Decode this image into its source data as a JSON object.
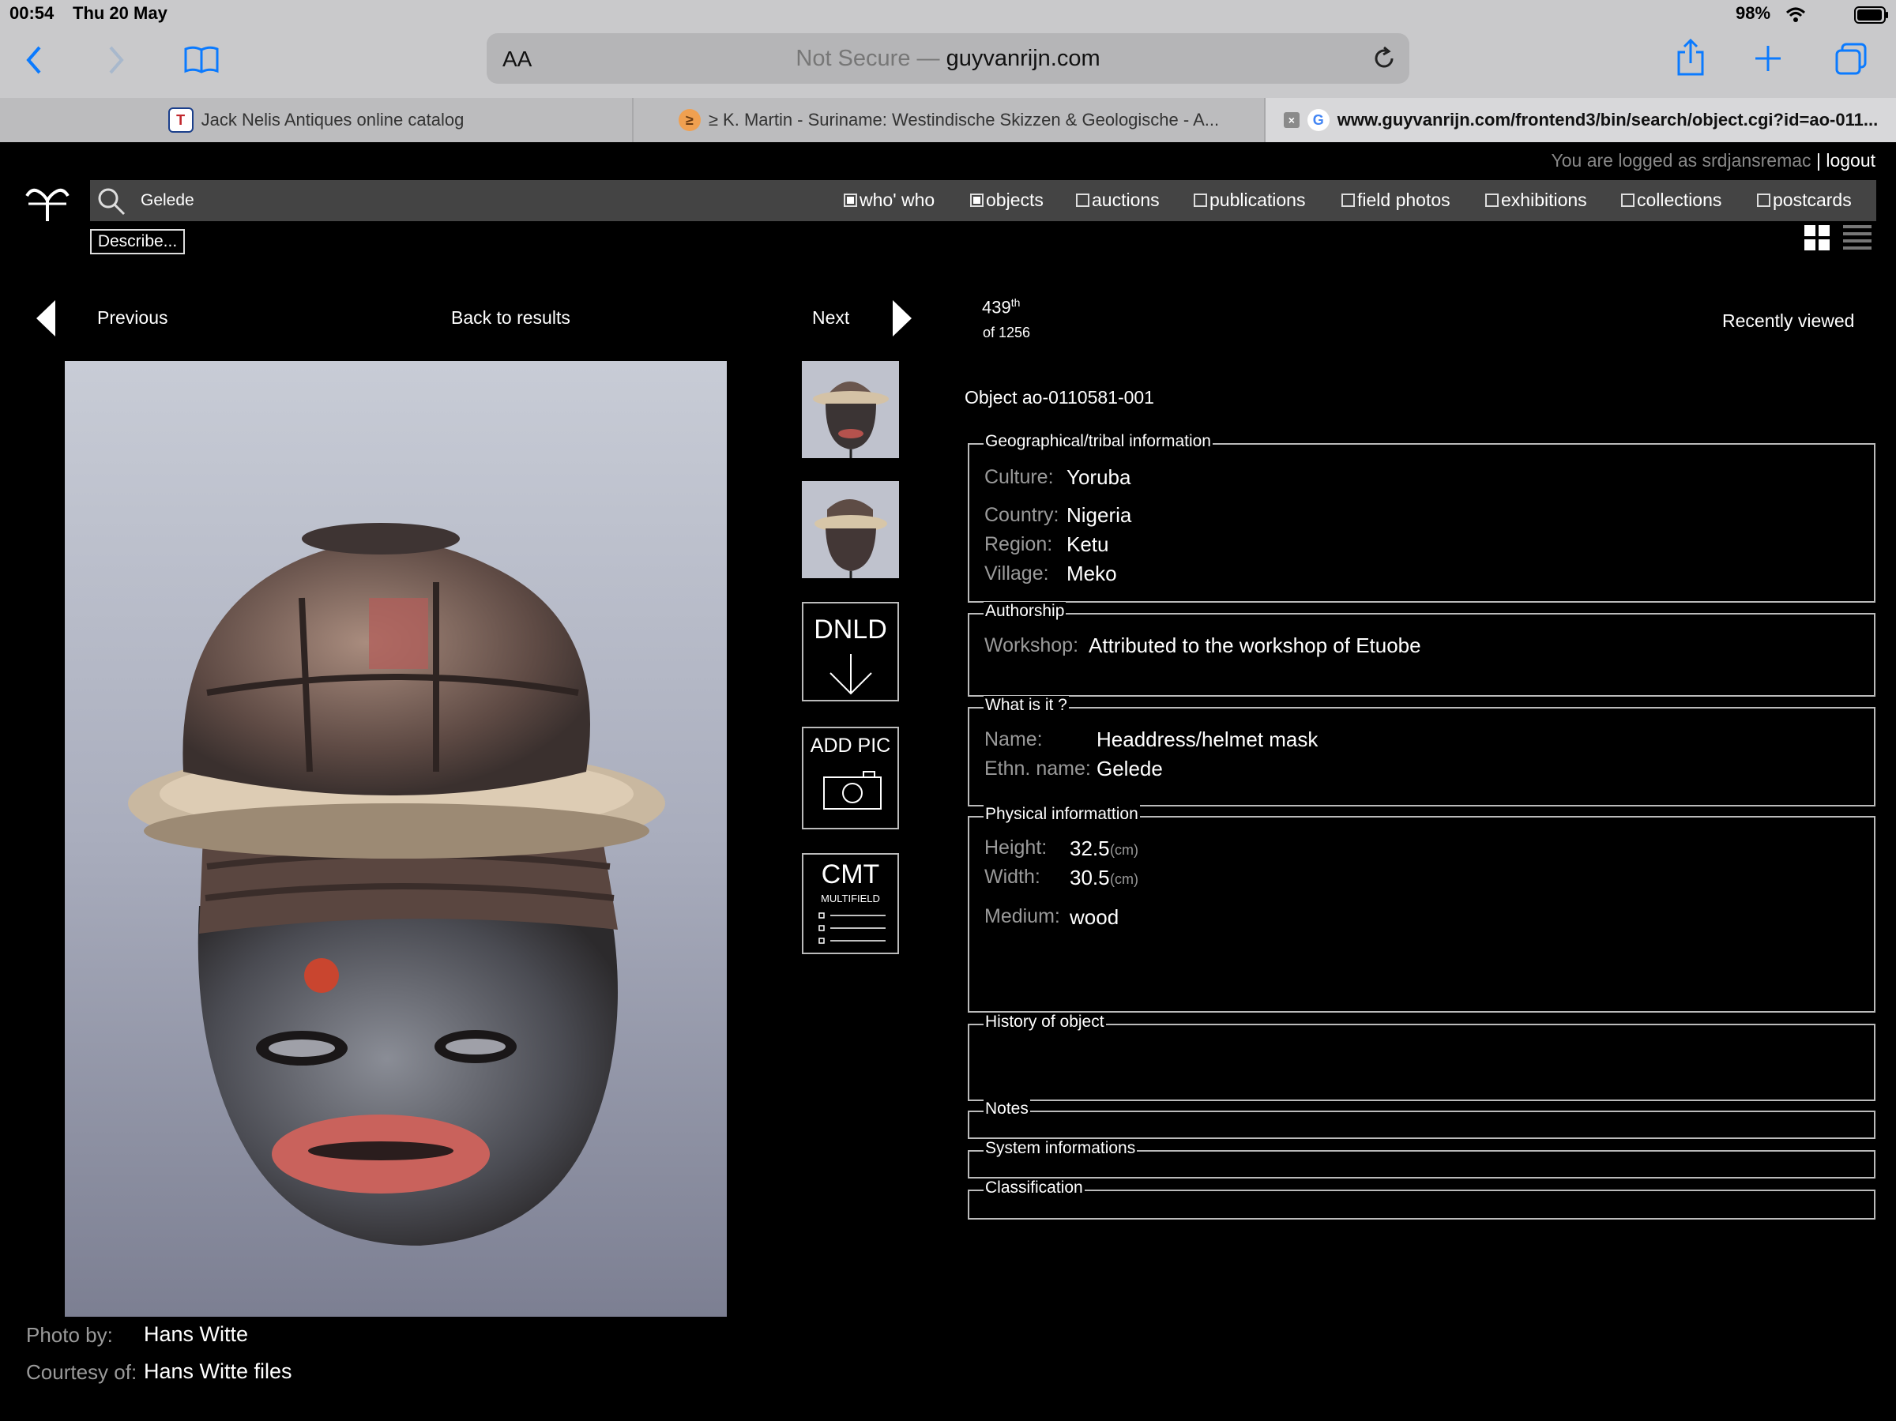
{
  "status": {
    "time": "00:54",
    "date": "Thu 20 May",
    "battery": "98%"
  },
  "browser": {
    "reader_label": "AA",
    "url_prefix": "Not Secure —",
    "url_domain": "guyvanrijn.com",
    "tabs": [
      {
        "title": "Jack Nelis Antiques online catalog",
        "favicon": "T"
      },
      {
        "title": "≥ K. Martin - Suriname: Westindische Skizzen & Geologische - A...",
        "favicon": "≥"
      },
      {
        "title": "www.guyvanrijn.com/frontend3/bin/search/object.cgi?id=ao-011...",
        "favicon": "G"
      }
    ]
  },
  "site": {
    "login_text": "You are logged as srdjansremac",
    "logout_label": "logout",
    "search_value": "Gelede",
    "filters": [
      {
        "label": "who' who",
        "checked": true
      },
      {
        "label": "objects",
        "checked": true
      },
      {
        "label": "auctions",
        "checked": false
      },
      {
        "label": "publications",
        "checked": false
      },
      {
        "label": "field photos",
        "checked": false
      },
      {
        "label": "exhibitions",
        "checked": false
      },
      {
        "label": "collections",
        "checked": false
      },
      {
        "label": "postcards",
        "checked": false
      }
    ],
    "describe_label": "Describe...",
    "nav": {
      "previous": "Previous",
      "back": "Back to results",
      "next": "Next"
    },
    "rank": {
      "number": "439",
      "suffix": "th",
      "total": "of 1256"
    },
    "recently_viewed": "Recently viewed",
    "actions": {
      "download": "DNLD",
      "add_pic": "ADD PIC",
      "comment": "CMT",
      "comment_sub": "MULTIFIELD"
    }
  },
  "object": {
    "id_text": "Object ao-0110581-001",
    "geo": {
      "legend": "Geographical/tribal information",
      "culture_label": "Culture:",
      "culture": "Yoruba",
      "country_label": "Country:",
      "country": "Nigeria",
      "region_label": "Region:",
      "region": "Ketu",
      "village_label": "Village:",
      "village": "Meko"
    },
    "authorship": {
      "legend": "Authorship",
      "workshop_label": "Workshop:",
      "workshop": "Attributed to the workshop of Etuobe"
    },
    "what": {
      "legend": "What is it ?",
      "name_label": "Name:",
      "name": "Headdress/helmet mask",
      "ethn_label": "Ethn. name:",
      "ethn": "Gelede"
    },
    "physical": {
      "legend": "Physical informattion",
      "height_label": "Height:",
      "height": "32.5",
      "height_unit": "(cm)",
      "width_label": "Width:",
      "width": "30.5",
      "width_unit": "(cm)",
      "medium_label": "Medium:",
      "medium": "wood"
    },
    "history_legend": "History of object",
    "notes_legend": "Notes",
    "system_legend": "System informations",
    "classification_legend": "Classification"
  },
  "credits": {
    "photo_label": "Photo by:",
    "photo": "Hans Witte",
    "courtesy_label": "Courtesy of:",
    "courtesy": "Hans Witte files"
  },
  "colors": {
    "accent": "#0a7aff",
    "background": "#000000",
    "chrome": "#c9c9cb"
  },
  "icons": [
    "back-icon",
    "forward-icon",
    "bookmarks-icon",
    "reload-icon",
    "share-icon",
    "new-tab-icon",
    "tabs-icon",
    "wifi-icon",
    "battery-icon",
    "search-icon",
    "grid-view-icon",
    "list-view-icon",
    "camera-icon",
    "download-arrow-icon"
  ]
}
